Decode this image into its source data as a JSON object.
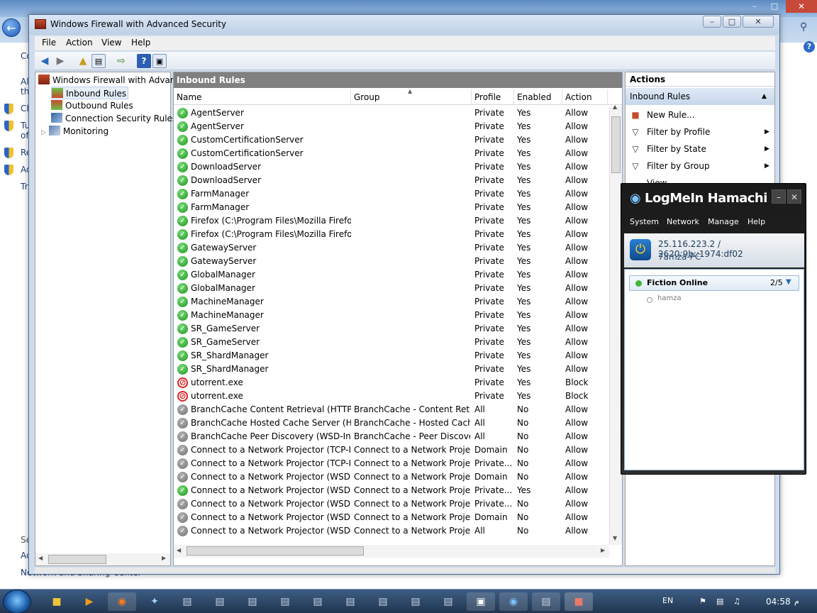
{
  "background_window": {
    "left_links": [
      "Co",
      "All",
      "th",
      "Ch",
      "Tu",
      "of",
      "Re",
      "Ad",
      "Tr",
      "Se",
      "Ac",
      "Network and Sharing Center"
    ]
  },
  "firewall": {
    "title": "Windows Firewall with Advanced Security",
    "menu": [
      "File",
      "Action",
      "View",
      "Help"
    ],
    "tree": {
      "root": "Windows Firewall with Advance",
      "items": [
        "Inbound Rules",
        "Outbound Rules",
        "Connection Security Rules",
        "Monitoring"
      ]
    },
    "center_title": "Inbound Rules",
    "columns": [
      "Name",
      "Group",
      "Profile",
      "Enabled",
      "Action"
    ],
    "rules": [
      {
        "name": "AgentServer",
        "group": "",
        "profile": "Private",
        "enabled": "Yes",
        "action": "Allow",
        "state": "en"
      },
      {
        "name": "AgentServer",
        "group": "",
        "profile": "Private",
        "enabled": "Yes",
        "action": "Allow",
        "state": "en"
      },
      {
        "name": "CustomCertificationServer",
        "group": "",
        "profile": "Private",
        "enabled": "Yes",
        "action": "Allow",
        "state": "en"
      },
      {
        "name": "CustomCertificationServer",
        "group": "",
        "profile": "Private",
        "enabled": "Yes",
        "action": "Allow",
        "state": "en"
      },
      {
        "name": "DownloadServer",
        "group": "",
        "profile": "Private",
        "enabled": "Yes",
        "action": "Allow",
        "state": "en"
      },
      {
        "name": "DownloadServer",
        "group": "",
        "profile": "Private",
        "enabled": "Yes",
        "action": "Allow",
        "state": "en"
      },
      {
        "name": "FarmManager",
        "group": "",
        "profile": "Private",
        "enabled": "Yes",
        "action": "Allow",
        "state": "en"
      },
      {
        "name": "FarmManager",
        "group": "",
        "profile": "Private",
        "enabled": "Yes",
        "action": "Allow",
        "state": "en"
      },
      {
        "name": "Firefox (C:\\Program Files\\Mozilla Firefox)",
        "group": "",
        "profile": "Private",
        "enabled": "Yes",
        "action": "Allow",
        "state": "en"
      },
      {
        "name": "Firefox (C:\\Program Files\\Mozilla Firefox)",
        "group": "",
        "profile": "Private",
        "enabled": "Yes",
        "action": "Allow",
        "state": "en"
      },
      {
        "name": "GatewayServer",
        "group": "",
        "profile": "Private",
        "enabled": "Yes",
        "action": "Allow",
        "state": "en"
      },
      {
        "name": "GatewayServer",
        "group": "",
        "profile": "Private",
        "enabled": "Yes",
        "action": "Allow",
        "state": "en"
      },
      {
        "name": "GlobalManager",
        "group": "",
        "profile": "Private",
        "enabled": "Yes",
        "action": "Allow",
        "state": "en"
      },
      {
        "name": "GlobalManager",
        "group": "",
        "profile": "Private",
        "enabled": "Yes",
        "action": "Allow",
        "state": "en"
      },
      {
        "name": "MachineManager",
        "group": "",
        "profile": "Private",
        "enabled": "Yes",
        "action": "Allow",
        "state": "en"
      },
      {
        "name": "MachineManager",
        "group": "",
        "profile": "Private",
        "enabled": "Yes",
        "action": "Allow",
        "state": "en"
      },
      {
        "name": "SR_GameServer",
        "group": "",
        "profile": "Private",
        "enabled": "Yes",
        "action": "Allow",
        "state": "en"
      },
      {
        "name": "SR_GameServer",
        "group": "",
        "profile": "Private",
        "enabled": "Yes",
        "action": "Allow",
        "state": "en"
      },
      {
        "name": "SR_ShardManager",
        "group": "",
        "profile": "Private",
        "enabled": "Yes",
        "action": "Allow",
        "state": "en"
      },
      {
        "name": "SR_ShardManager",
        "group": "",
        "profile": "Private",
        "enabled": "Yes",
        "action": "Allow",
        "state": "en"
      },
      {
        "name": "utorrent.exe",
        "group": "",
        "profile": "Private",
        "enabled": "Yes",
        "action": "Block",
        "state": "bl"
      },
      {
        "name": "utorrent.exe",
        "group": "",
        "profile": "Private",
        "enabled": "Yes",
        "action": "Block",
        "state": "bl"
      },
      {
        "name": "BranchCache Content Retrieval (HTTP-In)",
        "group": "BranchCache - Content Retr...",
        "profile": "All",
        "enabled": "No",
        "action": "Allow",
        "state": "dis"
      },
      {
        "name": "BranchCache Hosted Cache Server (HTT...",
        "group": "BranchCache - Hosted Cach...",
        "profile": "All",
        "enabled": "No",
        "action": "Allow",
        "state": "dis"
      },
      {
        "name": "BranchCache Peer Discovery (WSD-In)",
        "group": "BranchCache - Peer Discove...",
        "profile": "All",
        "enabled": "No",
        "action": "Allow",
        "state": "dis"
      },
      {
        "name": "Connect to a Network Projector (TCP-In)",
        "group": "Connect to a Network Proje...",
        "profile": "Domain",
        "enabled": "No",
        "action": "Allow",
        "state": "dis"
      },
      {
        "name": "Connect to a Network Projector (TCP-In)",
        "group": "Connect to a Network Proje...",
        "profile": "Private...",
        "enabled": "No",
        "action": "Allow",
        "state": "dis"
      },
      {
        "name": "Connect to a Network Projector (WSD Ev...",
        "group": "Connect to a Network Proje...",
        "profile": "Domain",
        "enabled": "No",
        "action": "Allow",
        "state": "dis"
      },
      {
        "name": "Connect to a Network Projector (WSD Ev...",
        "group": "Connect to a Network Proje...",
        "profile": "Private...",
        "enabled": "Yes",
        "action": "Allow",
        "state": "en"
      },
      {
        "name": "Connect to a Network Projector (WSD Ev...",
        "group": "Connect to a Network Proje...",
        "profile": "Private...",
        "enabled": "No",
        "action": "Allow",
        "state": "dis"
      },
      {
        "name": "Connect to a Network Projector (WSD Ev...",
        "group": "Connect to a Network Proje...",
        "profile": "Domain",
        "enabled": "No",
        "action": "Allow",
        "state": "dis"
      },
      {
        "name": "Connect to a Network Projector (WSD-In)",
        "group": "Connect to a Network Proje...",
        "profile": "All",
        "enabled": "No",
        "action": "Allow",
        "state": "dis"
      }
    ],
    "actions": {
      "title": "Actions",
      "section": "Inbound Rules",
      "items": [
        "New Rule...",
        "Filter by Profile",
        "Filter by State",
        "Filter by Group",
        "View"
      ]
    }
  },
  "hamachi": {
    "title": "LogMeIn Hamachi",
    "menu": [
      "System",
      "Network",
      "Manage",
      "Help"
    ],
    "ip": "25.116.223.2 / 2620:9b::1974:df02",
    "computer": "7amza-PC",
    "network": {
      "name": "Fiction Online",
      "count": "2/5"
    },
    "member": "hamza"
  },
  "taskbar": {
    "lang": "EN",
    "time": "04:58",
    "ampm": "م"
  }
}
